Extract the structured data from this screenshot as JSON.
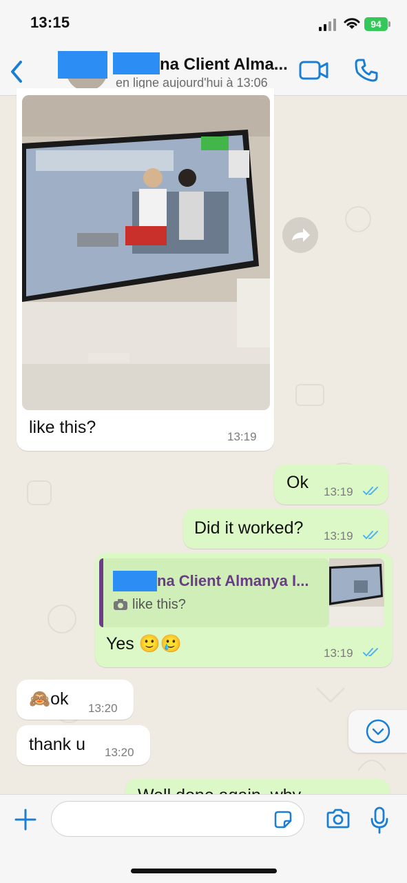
{
  "status_bar": {
    "time": "13:15",
    "battery": "94"
  },
  "header": {
    "contact_name": "na Client Alma...",
    "contact_status": "en ligne aujourd'hui à 13:06"
  },
  "messages": [
    {
      "id": "m1",
      "direction": "incoming",
      "type": "image",
      "caption": "like this?",
      "time": "13:19"
    },
    {
      "id": "m2",
      "direction": "outgoing",
      "text": "Ok",
      "time": "13:19",
      "status": "read"
    },
    {
      "id": "m3",
      "direction": "outgoing",
      "text": "Did it worked?",
      "time": "13:19",
      "status": "read"
    },
    {
      "id": "m4",
      "direction": "outgoing",
      "text": "Yes 🙂🥲",
      "time": "13:19",
      "status": "read",
      "reply": {
        "name": "na Client Almanya I...",
        "text": "like this?"
      }
    },
    {
      "id": "m5",
      "direction": "incoming",
      "text": "🙈ok",
      "time": "13:20"
    },
    {
      "id": "m6",
      "direction": "incoming",
      "text": "thank u",
      "time": "13:20"
    },
    {
      "id": "m7",
      "direction": "outgoing",
      "text": "Well done again, why…",
      "partial": true
    }
  ],
  "icons": {
    "back": "chevron-left-icon",
    "video": "video-camera-icon",
    "call": "phone-icon",
    "forward": "share-arrow-icon",
    "scroll": "chevron-down-icon",
    "plus": "plus-icon",
    "sticker": "sticker-icon",
    "camera": "camera-icon",
    "mic": "microphone-icon"
  },
  "colors": {
    "accent": "#1a7fd4",
    "outgoing_bubble": "#dcf8c6",
    "read_tick": "#4fb3f6",
    "reply_name": "#6a3c86"
  }
}
